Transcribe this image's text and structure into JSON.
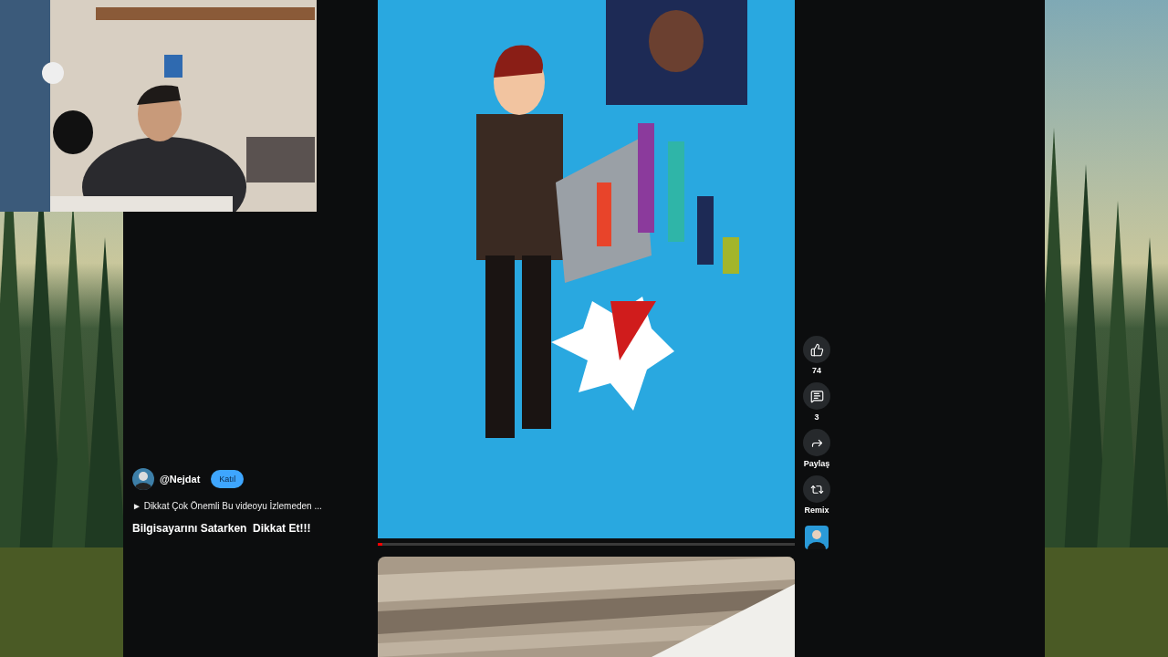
{
  "channel": {
    "handle": "@Nejdat",
    "join_button": "Katıl"
  },
  "description": "► Dikkat Çok Önemli Bu videoyu İzlemeden ...",
  "title": "Bilgisayarını Satarken  Dikkat Et!!!",
  "progress": {
    "level": 0.01
  },
  "actions": [
    {
      "kind": "like",
      "label": "74"
    },
    {
      "kind": "comment",
      "label": "3"
    },
    {
      "kind": "share",
      "label": "Paylaş"
    },
    {
      "kind": "remix",
      "label": "Remix"
    }
  ]
}
